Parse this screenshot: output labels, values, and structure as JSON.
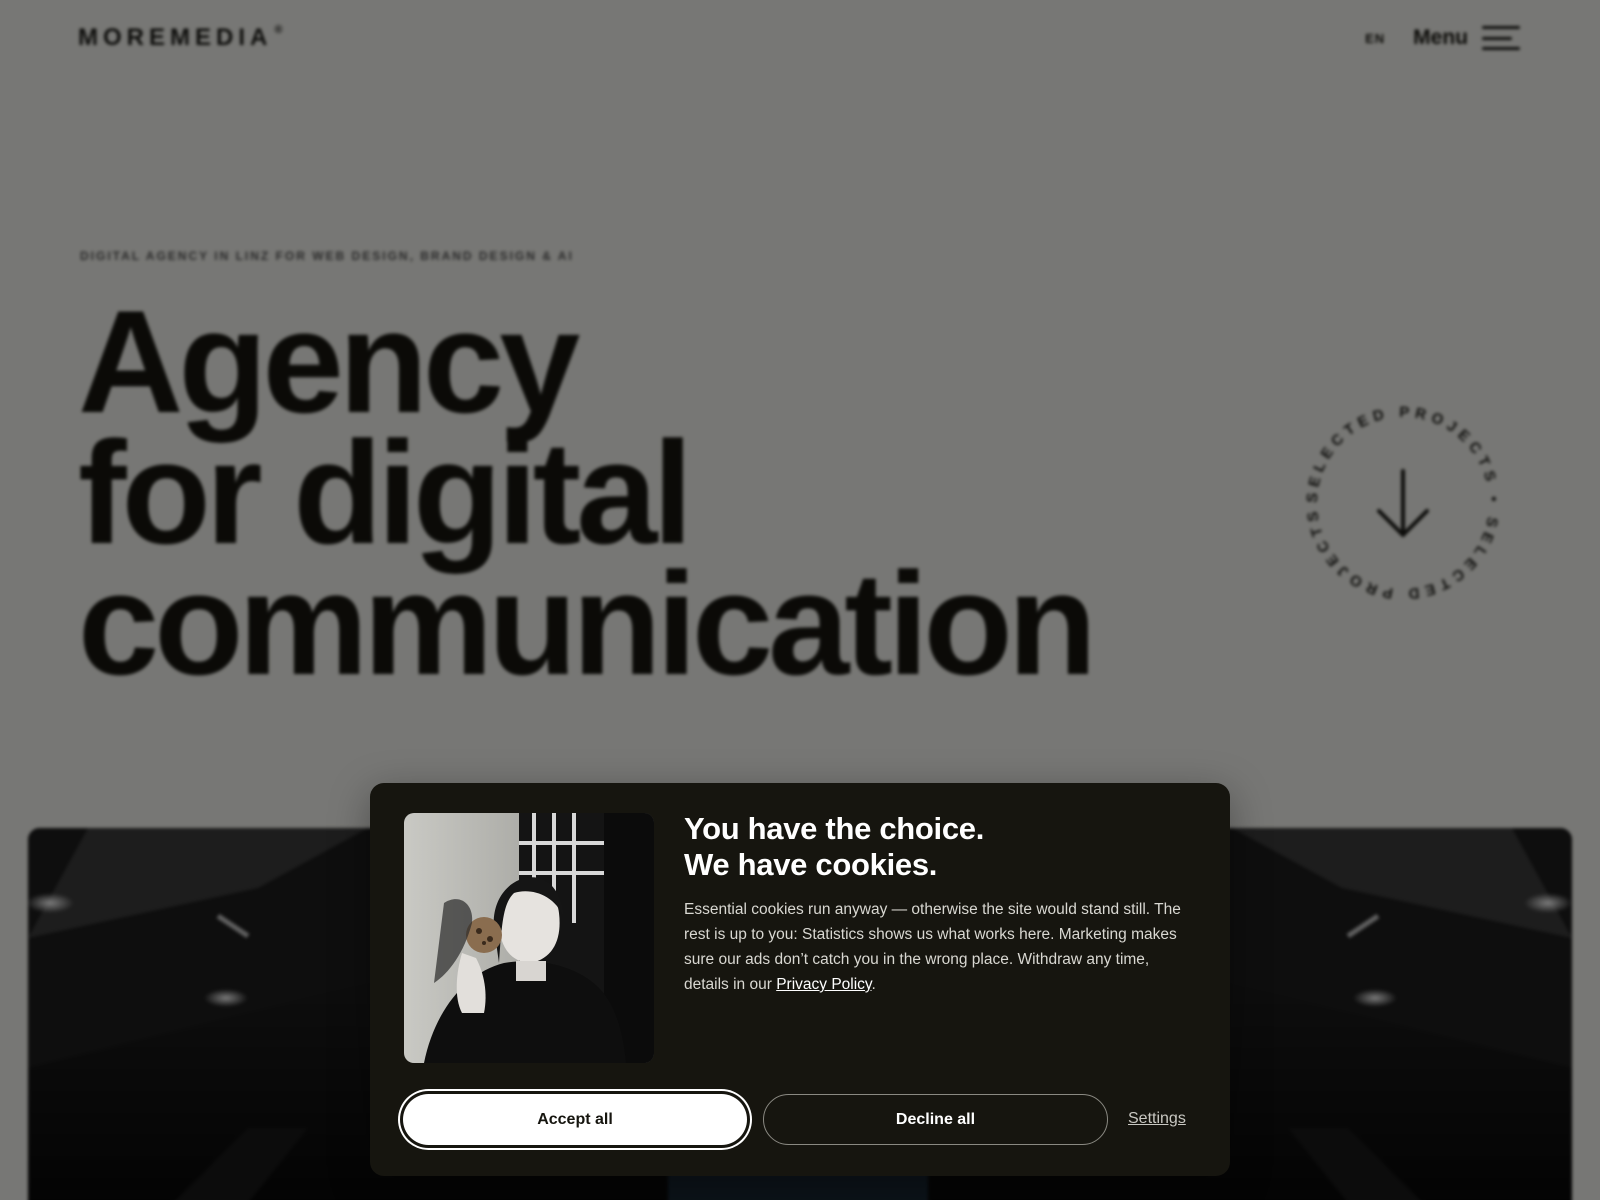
{
  "header": {
    "logo": "MOREMEDIA",
    "logo_mark": "®",
    "language": "EN",
    "menu_label": "Menu"
  },
  "hero": {
    "eyebrow": "DIGITAL AGENCY IN LINZ FOR WEB DESIGN, BRAND DESIGN & AI",
    "headline_lines": [
      "Agency",
      "for digital",
      "communication"
    ],
    "scroll_badge_text": "SELECTED PROJECTS • SELECTED PROJECTS • "
  },
  "cookie": {
    "title_line1": "You have the choice.",
    "title_line2": "We have cookies.",
    "body": "Essential cookies run anyway — otherwise the site would stand still. The rest is up to you: Statistics shows us what works here. Marketing makes sure our ads don’t catch you in the wrong place. Withdraw any time, details in our ",
    "privacy_link": "Privacy Policy",
    "body_end": ".",
    "accept_label": "Accept all",
    "decline_label": "Decline all",
    "settings_label": "Settings"
  },
  "colors": {
    "page_bg": "#efefea",
    "ink": "#16150f",
    "modal_bg": "#16150f",
    "button_light": "#ffffff"
  }
}
